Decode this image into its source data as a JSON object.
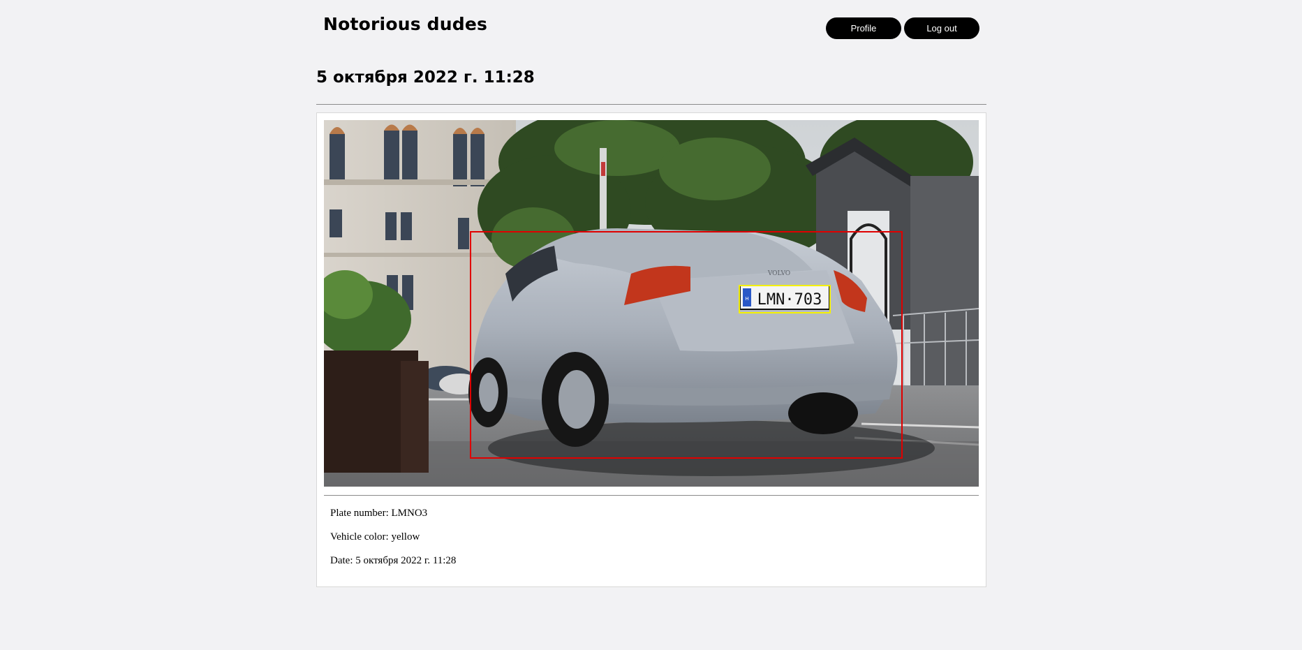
{
  "header": {
    "brand": "Notorious dudes",
    "profile_label": "Profile",
    "logout_label": "Log out"
  },
  "page": {
    "title": "5 октября 2022 г. 11:28"
  },
  "detection": {
    "image_plate_text": "LMN·703",
    "plate_country": "H",
    "car_brand_badge": "VOLVO",
    "vehicle_box_color": "#e00000",
    "plate_box_color": "#f4f000"
  },
  "details": {
    "plate_label": "Plate number: ",
    "plate_value": "LMNO3",
    "color_label": "Vehicle color: ",
    "color_value": "yellow",
    "date_label": "Date: ",
    "date_value": "5 октября 2022 г. 11:28"
  },
  "colors": {
    "page_bg": "#f2f2f4",
    "button_bg": "#000000",
    "button_text": "#ffffff"
  }
}
